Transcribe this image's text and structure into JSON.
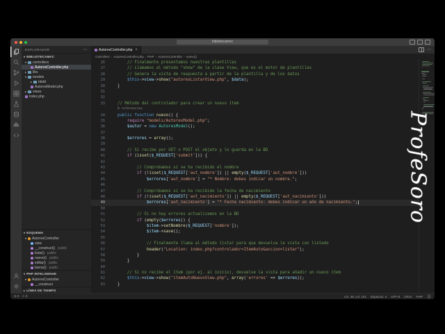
{
  "titlebar": {
    "title": "bibliotecamvc"
  },
  "watermark": "ProfeSoro",
  "activity_bar": [
    "explorer",
    "search",
    "source-control",
    "run-debug",
    "extensions",
    "testing",
    "database",
    "docker",
    "remote"
  ],
  "activity_bar_bottom": [
    "account",
    "settings"
  ],
  "sidebar": {
    "title": "EXPLORADOR",
    "project": "BIBLIOTECAMVC",
    "tree": [
      {
        "label": "controllers",
        "icon": "folder",
        "expanded": true,
        "indent": 0
      },
      {
        "label": "AutoresController.php",
        "icon": "php",
        "indent": 1,
        "selected": true
      },
      {
        "label": "libs",
        "icon": "folder",
        "indent": 0
      },
      {
        "label": "models",
        "icon": "folder",
        "expanded": true,
        "indent": 0
      },
      {
        "label": "bbdd",
        "icon": "folder",
        "indent": 1
      },
      {
        "label": "AutoresModel.php",
        "icon": "php",
        "indent": 1
      },
      {
        "label": "views",
        "icon": "folder",
        "indent": 0
      },
      {
        "label": "index.php",
        "icon": "php",
        "indent": 0
      }
    ],
    "outline": {
      "title": "ESQUEMA",
      "items": [
        {
          "label": "AutoresController",
          "detail": "",
          "icon": "class",
          "indent": 0,
          "expanded": true
        },
        {
          "label": "view",
          "detail": "",
          "icon": "property",
          "indent": 1
        },
        {
          "label": "__construct()",
          "detail": "public",
          "icon": "method",
          "indent": 1
        },
        {
          "label": "listar()",
          "detail": "public",
          "icon": "method",
          "indent": 1
        },
        {
          "label": "nuevo()",
          "detail": "public",
          "icon": "method",
          "indent": 1
        },
        {
          "label": "editar()",
          "detail": "public",
          "icon": "method",
          "indent": 1
        },
        {
          "label": "borrar()",
          "detail": "public",
          "icon": "method",
          "indent": 1
        }
      ]
    },
    "intellisense": {
      "title": "PHP INTELISENSE",
      "items": [
        {
          "label": "AutoresController",
          "detail": "",
          "icon": "class",
          "indent": 0,
          "expanded": true
        },
        {
          "label": "__construct",
          "detail": "",
          "icon": "method",
          "indent": 1
        }
      ]
    },
    "timeline": {
      "title": "LÍNEA DE TIEMPO"
    }
  },
  "editor": {
    "tab": "AutoresController.php",
    "breadcrumbs": [
      "controllers",
      "AutoresController.php",
      "PHP",
      "AutoresController",
      "nuevo()"
    ],
    "cursor": {
      "line": 49
    },
    "code_lines": [
      {
        "n": 26,
        "t": [
          [
            "cm",
            "        // Finalmente presentamos nuestras plantillas"
          ]
        ]
      },
      {
        "n": 27,
        "t": [
          [
            "cm",
            "        // Llamamos al método \"show\" de la clase View, que es el motor de plantillas"
          ]
        ]
      },
      {
        "n": 28,
        "t": [
          [
            "cm",
            "        // Genera la vista de respuesta a partir de la plantilla y de los datos"
          ]
        ]
      },
      {
        "n": 29,
        "t": [
          [
            "p",
            "        "
          ],
          [
            "th",
            "$this"
          ],
          [
            "o",
            "->"
          ],
          [
            "v",
            "view"
          ],
          [
            "o",
            "->"
          ],
          [
            "fn",
            "show"
          ],
          [
            "p",
            "("
          ],
          [
            "s",
            "\"autoresListarView.php\""
          ],
          [
            "p",
            ", "
          ],
          [
            "v",
            "$data"
          ],
          [
            "p",
            ");"
          ]
        ]
      },
      {
        "n": 30,
        "t": [
          [
            "p",
            "    }"
          ]
        ]
      },
      {
        "n": 31,
        "t": []
      },
      {
        "n": 32,
        "t": []
      },
      {
        "n": 33,
        "t": [
          [
            "cm",
            "    // Método del controlador para crear un nuevo ítem"
          ]
        ]
      },
      {
        "lens": "0 referencias"
      },
      {
        "n": 34,
        "t": [
          [
            "p",
            "    "
          ],
          [
            "k",
            "public"
          ],
          [
            "p",
            " "
          ],
          [
            "k",
            "function"
          ],
          [
            "p",
            " "
          ],
          [
            "fn",
            "nuevo"
          ],
          [
            "p",
            "() {"
          ]
        ]
      },
      {
        "n": 35,
        "t": [
          [
            "p",
            "        "
          ],
          [
            "kc",
            "require"
          ],
          [
            "p",
            " "
          ],
          [
            "s",
            "\"models/AutoresModel.php\""
          ],
          [
            "p",
            ";"
          ]
        ]
      },
      {
        "n": 36,
        "t": [
          [
            "p",
            "        "
          ],
          [
            "v",
            "$autor"
          ],
          [
            "o",
            " = "
          ],
          [
            "k",
            "new"
          ],
          [
            "p",
            " "
          ],
          [
            "cl",
            "AutoresModel"
          ],
          [
            "p",
            "();"
          ]
        ]
      },
      {
        "n": 37,
        "t": []
      },
      {
        "n": 38,
        "t": [
          [
            "p",
            "        "
          ],
          [
            "v",
            "$errores"
          ],
          [
            "o",
            " = "
          ],
          [
            "fn",
            "array"
          ],
          [
            "p",
            "();"
          ]
        ]
      },
      {
        "n": 39,
        "t": []
      },
      {
        "n": 40,
        "t": [
          [
            "cm",
            "        // Si recibe por GET o POST el objeto y lo guarda en la BD"
          ]
        ]
      },
      {
        "n": 41,
        "t": [
          [
            "p",
            "        "
          ],
          [
            "kc",
            "if"
          ],
          [
            "p",
            " ("
          ],
          [
            "fn",
            "isset"
          ],
          [
            "p",
            "("
          ],
          [
            "v",
            "$_REQUEST"
          ],
          [
            "p",
            "["
          ],
          [
            "s",
            "'submit'"
          ],
          [
            "p",
            "])) {"
          ]
        ]
      },
      {
        "n": 42,
        "t": []
      },
      {
        "n": 43,
        "t": [
          [
            "cm",
            "            // Comprobamos si se ha recibido el nombre"
          ]
        ]
      },
      {
        "n": 44,
        "t": [
          [
            "p",
            "            "
          ],
          [
            "kc",
            "if"
          ],
          [
            "p",
            " (!"
          ],
          [
            "fn",
            "isset"
          ],
          [
            "p",
            "("
          ],
          [
            "v",
            "$_REQUEST"
          ],
          [
            "p",
            "["
          ],
          [
            "s",
            "'aut_nombre'"
          ],
          [
            "p",
            "]) || "
          ],
          [
            "fn",
            "empty"
          ],
          [
            "p",
            "("
          ],
          [
            "v",
            "$_REQUEST"
          ],
          [
            "p",
            "["
          ],
          [
            "s",
            "'aut_nombre'"
          ],
          [
            "p",
            "]))"
          ]
        ]
      },
      {
        "n": 45,
        "t": [
          [
            "p",
            "                "
          ],
          [
            "v",
            "$errores"
          ],
          [
            "p",
            "["
          ],
          [
            "s",
            "'aut_nombre'"
          ],
          [
            "o",
            "] = "
          ],
          [
            "s",
            "\"* Nombre: debes indicar un nombre.\""
          ],
          [
            "p",
            ";"
          ]
        ]
      },
      {
        "n": 46,
        "t": []
      },
      {
        "n": 47,
        "t": [
          [
            "cm",
            "            // Comprobamos si se ha recibido la fecha de nacimiento"
          ]
        ]
      },
      {
        "n": 48,
        "t": [
          [
            "p",
            "            "
          ],
          [
            "kc",
            "if"
          ],
          [
            "p",
            " (!"
          ],
          [
            "fn",
            "isset"
          ],
          [
            "p",
            "("
          ],
          [
            "v",
            "$_REQUEST"
          ],
          [
            "p",
            "["
          ],
          [
            "s",
            "'aut_nacimiento'"
          ],
          [
            "p",
            "]) || "
          ],
          [
            "fn",
            "empty"
          ],
          [
            "p",
            "("
          ],
          [
            "v",
            "$_REQUEST"
          ],
          [
            "p",
            "["
          ],
          [
            "s",
            "'aut_nacimiento'"
          ],
          [
            "p",
            "]))"
          ]
        ]
      },
      {
        "n": 49,
        "t": [
          [
            "p",
            "                "
          ],
          [
            "v",
            "$errores"
          ],
          [
            "p",
            "["
          ],
          [
            "s",
            "'aut_nacimiento'"
          ],
          [
            "o",
            "] = "
          ],
          [
            "s",
            "\"* Fecha nacimiento: debes indicar un año de nacimiento.\""
          ],
          [
            "p",
            ";"
          ]
        ]
      },
      {
        "n": 50,
        "t": []
      },
      {
        "n": 51,
        "t": [
          [
            "cm",
            "            // Si no hay errores actualizamos en la BD"
          ]
        ]
      },
      {
        "n": 52,
        "t": [
          [
            "p",
            "            "
          ],
          [
            "kc",
            "if"
          ],
          [
            "p",
            " ("
          ],
          [
            "fn",
            "empty"
          ],
          [
            "p",
            "("
          ],
          [
            "v",
            "$errores"
          ],
          [
            "p",
            ")) {"
          ]
        ]
      },
      {
        "n": 53,
        "t": [
          [
            "p",
            "                "
          ],
          [
            "v",
            "$item"
          ],
          [
            "o",
            "->"
          ],
          [
            "fn",
            "setNombre"
          ],
          [
            "p",
            "("
          ],
          [
            "v",
            "$_REQUEST"
          ],
          [
            "p",
            "["
          ],
          [
            "s",
            "'nombre'"
          ],
          [
            "p",
            "]);"
          ]
        ]
      },
      {
        "n": 54,
        "t": [
          [
            "p",
            "                "
          ],
          [
            "v",
            "$item"
          ],
          [
            "o",
            "->"
          ],
          [
            "fn",
            "save"
          ],
          [
            "p",
            "();"
          ]
        ]
      },
      {
        "n": 55,
        "t": []
      },
      {
        "n": 56,
        "t": [
          [
            "cm",
            "                // Finalmente llama al método listar para que devuelva la vista con listado"
          ]
        ]
      },
      {
        "n": 57,
        "t": [
          [
            "p",
            "                "
          ],
          [
            "fn",
            "header"
          ],
          [
            "p",
            "("
          ],
          [
            "s",
            "\"Location: index.php?controlador=ItemAuto&accion=listar\""
          ],
          [
            "p",
            ");"
          ]
        ]
      },
      {
        "n": 58,
        "t": [
          [
            "p",
            "            }"
          ]
        ]
      },
      {
        "n": 59,
        "t": [
          [
            "p",
            "        }"
          ]
        ]
      },
      {
        "n": 60,
        "t": []
      },
      {
        "n": 61,
        "t": [
          [
            "cm",
            "        // Si no recibe el ítem (por ej. al inicio), devuelve la vista para añadir un nuevo ítem"
          ]
        ]
      },
      {
        "n": 62,
        "t": [
          [
            "p",
            "        "
          ],
          [
            "th",
            "$this"
          ],
          [
            "o",
            "->"
          ],
          [
            "v",
            "view"
          ],
          [
            "o",
            "->"
          ],
          [
            "fn",
            "show"
          ],
          [
            "p",
            "("
          ],
          [
            "s",
            "\"itemAutoNuevoView.php\""
          ],
          [
            "p",
            ", "
          ],
          [
            "fn",
            "array"
          ],
          [
            "p",
            "("
          ],
          [
            "s",
            "'errores'"
          ],
          [
            "o",
            " => "
          ],
          [
            "v",
            "$errores"
          ],
          [
            "p",
            "));"
          ]
        ]
      },
      {
        "n": 63,
        "t": [
          [
            "p",
            "    }"
          ]
        ]
      }
    ]
  },
  "status": {
    "errors": "0",
    "warnings": "0",
    "items": [
      "Lín. 49, col. 101",
      "Espacios: 4",
      "UTF-8",
      "CRLF",
      "PHP"
    ]
  },
  "colors": {
    "accent": "#569cd6",
    "selection": "#3f4246",
    "comment": "#6a9955",
    "string": "#ce9178",
    "class_symbol": "#ee9d28",
    "method_symbol": "#b180d7",
    "property_symbol": "#75beff"
  }
}
